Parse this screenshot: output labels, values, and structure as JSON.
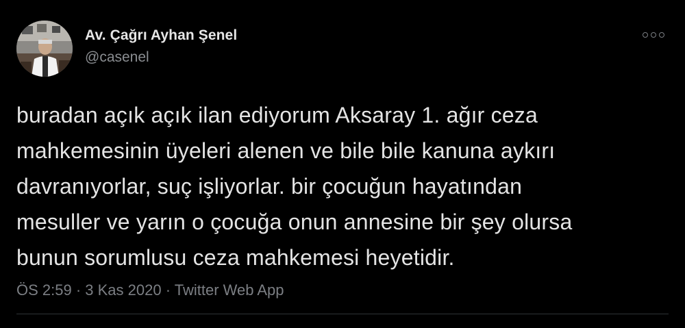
{
  "tweet": {
    "author": {
      "display_name": "Av. Çağrı Ayhan Şenel",
      "handle": "@casenel",
      "avatar_icon": "profile-photo"
    },
    "more_icon": "more-options-icon",
    "text_lines": [
      "buradan açık açık ilan ediyorum Aksaray 1. ağır ceza",
      "mahkemesinin üyeleri alenen ve bile bile kanuna aykırı",
      "davranıyorlar, suç işliyorlar. bir çocuğun hayatından",
      "mesuller ve yarın o çocuğa onun annesine bir şey olursa",
      "bunun sorumlusu ceza mahkemesi heyetidir."
    ],
    "meta": {
      "time": "ÖS 2:59",
      "separator": " · ",
      "date": "3 Kas 2020",
      "source": "Twitter Web App"
    }
  },
  "colors": {
    "background": "#000000",
    "text_primary": "#e4e4e4",
    "text_secondary": "#7c7f84",
    "divider": "#2f3336"
  }
}
